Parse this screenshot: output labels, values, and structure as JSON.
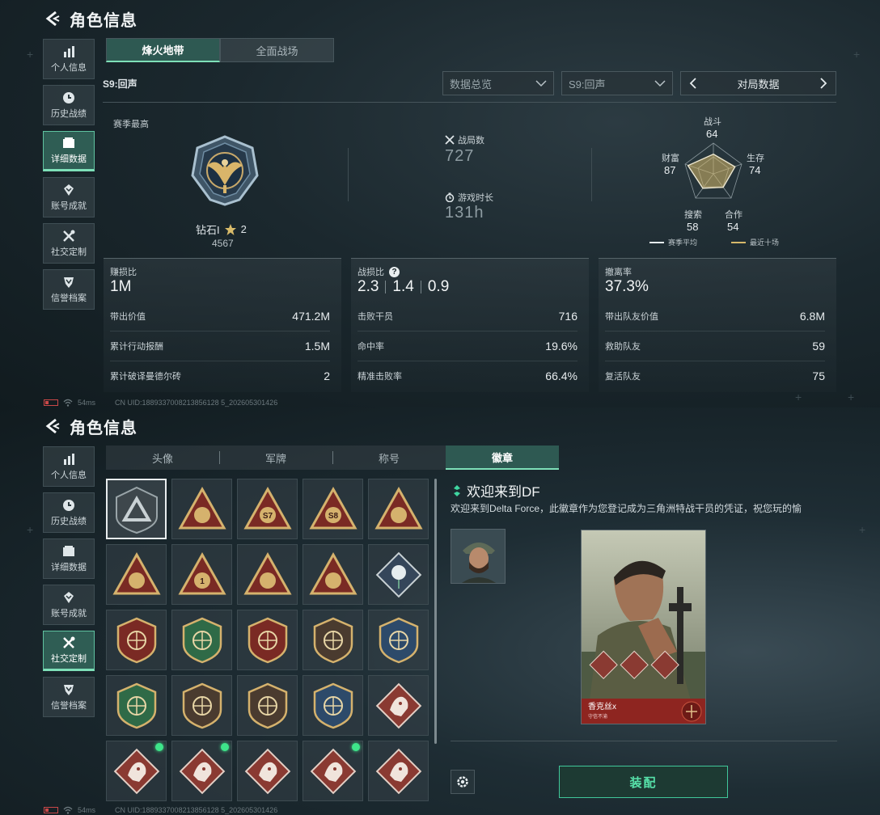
{
  "panels": [
    {
      "header": {
        "title": "角色信息"
      },
      "sidebar": {
        "items": [
          {
            "label": "个人信息",
            "icon": "bar-chart-icon"
          },
          {
            "label": "历史战绩",
            "icon": "clock-icon"
          },
          {
            "label": "详细数据",
            "icon": "folder-icon",
            "active": true
          },
          {
            "label": "账号成就",
            "icon": "achievement-icon"
          },
          {
            "label": "社交定制",
            "icon": "tools-icon"
          },
          {
            "label": "信誉档案",
            "icon": "shield-down-icon"
          }
        ]
      },
      "mode_tabs": [
        {
          "label": "烽火地带",
          "active": true
        },
        {
          "label": "全面战场"
        }
      ],
      "season_label": "S9:回声",
      "dropdowns": {
        "data_type": "数据总览",
        "season": "S9:回声",
        "stat_view": "对局数据"
      },
      "season_best": {
        "label": "赛季最高",
        "rank_name": "钻石I",
        "stars": "2",
        "score": "4567"
      },
      "stats": {
        "matches_label": "战局数",
        "matches_value": "727",
        "playtime_label": "游戏时长",
        "playtime_value": "131h"
      },
      "radar": {
        "combat_label": "战斗",
        "combat_value": "64",
        "survival_label": "生存",
        "survival_value": "74",
        "teamwork_label": "合作",
        "teamwork_value": "54",
        "search_label": "搜索",
        "search_value": "58",
        "wealth_label": "财富",
        "wealth_value": "87",
        "legend_avg": "赛季平均",
        "legend_recent": "最近十场",
        "colors": {
          "avg": "#e6ecee",
          "recent": "#d6b86a"
        }
      },
      "cards": {
        "profit": {
          "title": "赚损比",
          "value": "1M",
          "rows": [
            {
              "label": "带出价值",
              "value": "471.2M"
            },
            {
              "label": "累计行动报酬",
              "value": "1.5M"
            },
            {
              "label": "累计破译曼德尔砖",
              "value": "2"
            }
          ]
        },
        "kd": {
          "title": "战损比",
          "values": [
            "2.3",
            "1.4",
            "0.9"
          ],
          "rows": [
            {
              "label": "击败干员",
              "value": "716"
            },
            {
              "label": "命中率",
              "value": "19.6%"
            },
            {
              "label": "精准击败率",
              "value": "66.4%"
            }
          ]
        },
        "extract": {
          "title": "撤离率",
          "value": "37.3%",
          "rows": [
            {
              "label": "带出队友价值",
              "value": "6.8M"
            },
            {
              "label": "救助队友",
              "value": "59"
            },
            {
              "label": "复活队友",
              "value": "75"
            }
          ]
        }
      },
      "status": {
        "ping": "54ms",
        "uid": "CN UID:1889337008213856128 5_202605301426"
      }
    },
    {
      "header": {
        "title": "角色信息"
      },
      "sidebar": {
        "items": [
          {
            "label": "个人信息",
            "icon": "bar-chart-icon"
          },
          {
            "label": "历史战绩",
            "icon": "clock-icon"
          },
          {
            "label": "详细数据",
            "icon": "folder-icon"
          },
          {
            "label": "账号成就",
            "icon": "achievement-icon"
          },
          {
            "label": "社交定制",
            "icon": "tools-icon",
            "active": true
          },
          {
            "label": "信誉档案",
            "icon": "shield-down-icon"
          }
        ]
      },
      "tabs": [
        {
          "label": "头像"
        },
        {
          "label": "军牌"
        },
        {
          "label": "称号"
        },
        {
          "label": "徽章",
          "active": true
        }
      ],
      "badges": {
        "items": [
          {
            "name": "welcome-df-badge",
            "selected": true
          },
          {
            "name": "helicopter-badge"
          },
          {
            "name": "s7-badge",
            "text": "S7"
          },
          {
            "name": "s8-badge",
            "text": "S8"
          },
          {
            "name": "hand-sign-badge"
          },
          {
            "name": "helmet-badge"
          },
          {
            "name": "number-one-badge",
            "text": "1"
          },
          {
            "name": "lighter-badge"
          },
          {
            "name": "squad-badge"
          },
          {
            "name": "rose-badge"
          },
          {
            "name": "star-emblem-badge"
          },
          {
            "name": "green-shield-badge"
          },
          {
            "name": "stars-crest-badge"
          },
          {
            "name": "crystal-shield-badge"
          },
          {
            "name": "blue-crosshair-badge"
          },
          {
            "name": "green-crosshair-badge"
          },
          {
            "name": "rifle-shield-badge"
          },
          {
            "name": "gun-shield-badge"
          },
          {
            "name": "gold-crest-badge"
          },
          {
            "name": "wolf-diamond-badge"
          },
          {
            "name": "wolf-red-badge",
            "new": true
          },
          {
            "name": "lion-red-badge",
            "new": true
          },
          {
            "name": "dragon-red-badge"
          },
          {
            "name": "dragon-red-2-badge",
            "new": true
          },
          {
            "name": "raptor-red-badge"
          }
        ]
      },
      "detail": {
        "title": "欢迎来到DF",
        "description": "欢迎来到Delta Force，此徽章作为您登记成为三角洲特战干员的凭证，祝您玩的愉",
        "character_name": "香克丝x",
        "character_subtitle": "守信不渝",
        "equip_label": "装配"
      },
      "status": {
        "ping": "54ms",
        "uid": "CN UID:1889337008213856128 5_202605301426"
      }
    }
  ]
}
